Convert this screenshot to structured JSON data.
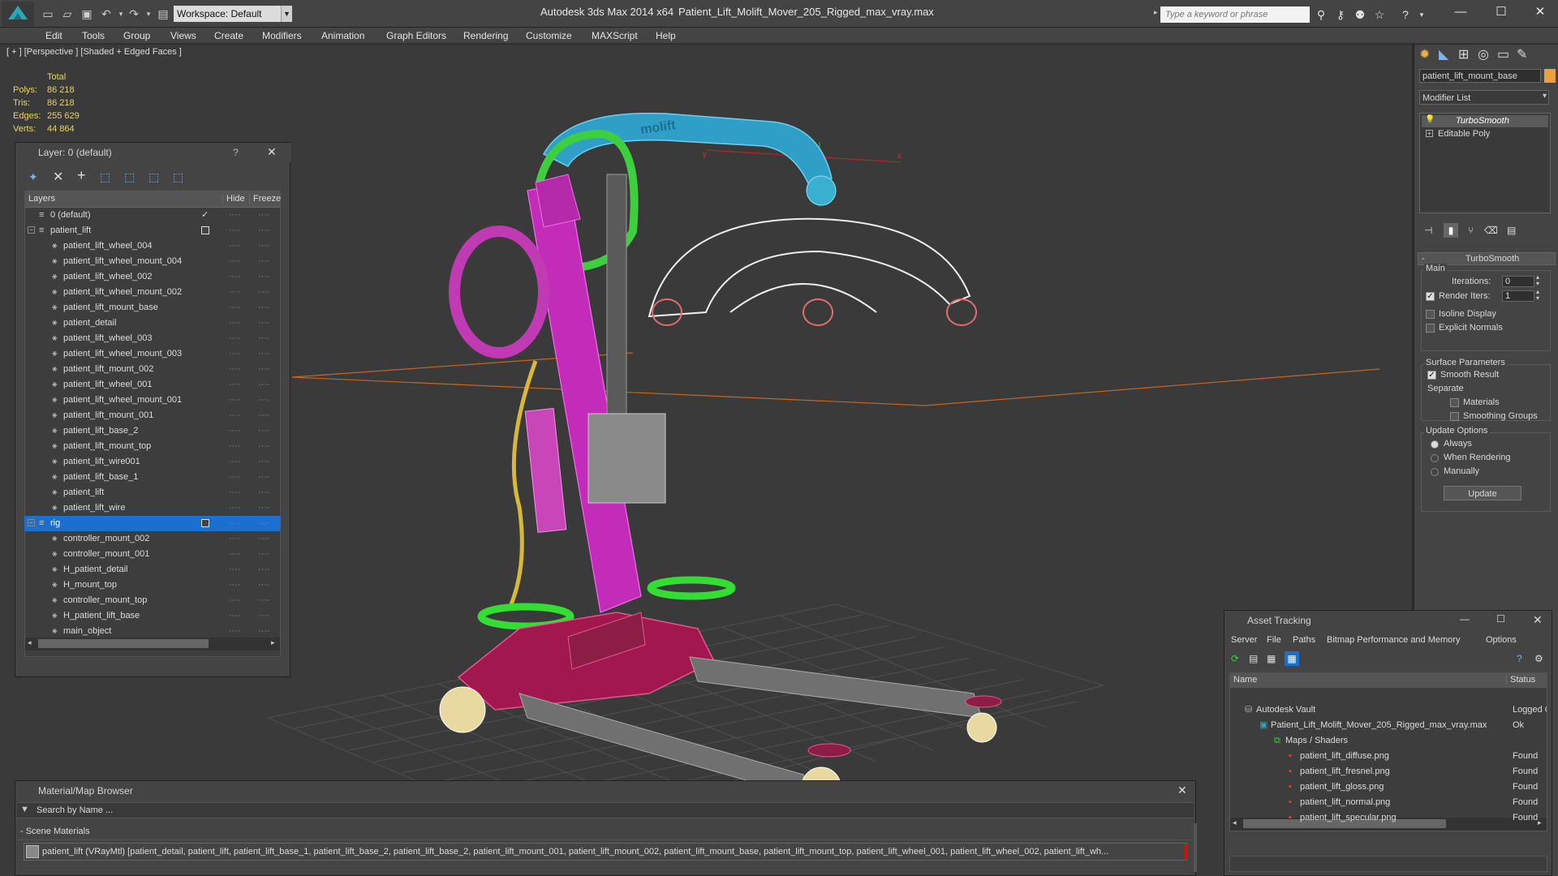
{
  "titlebar": {
    "workspace_label": "Workspace: Default",
    "app_name": "Autodesk 3ds Max  2014 x64",
    "file_name": "Patient_Lift_Molift_Mover_205_Rigged_max_vray.max",
    "search_placeholder": "Type a keyword or phrase"
  },
  "menu": [
    "Edit",
    "Tools",
    "Group",
    "Views",
    "Create",
    "Modifiers",
    "Animation",
    "Graph Editors",
    "Rendering",
    "Customize",
    "MAXScript",
    "Help"
  ],
  "viewport": {
    "label": "[ + ] [Perspective ] [Shaded + Edged Faces ]",
    "stats_header": "Total",
    "stats": [
      {
        "label": "Polys:",
        "value": "86 218"
      },
      {
        "label": "Tris:",
        "value": "86 218"
      },
      {
        "label": "Edges:",
        "value": "255 629"
      },
      {
        "label": "Verts:",
        "value": "44 864"
      }
    ],
    "axis_x": "x",
    "axis_y": "y",
    "logo_text": "molift"
  },
  "layer_panel": {
    "title": "Layer: 0 (default)",
    "help": "?",
    "col_layers": "Layers",
    "col_hide": "Hide",
    "col_freeze": "Freeze",
    "rows": [
      {
        "name": "0 (default)",
        "level": 0,
        "expander": "",
        "check": true
      },
      {
        "name": "patient_lift",
        "level": 0,
        "expander": "−",
        "box": true
      },
      {
        "name": "patient_lift_wheel_004",
        "level": 1
      },
      {
        "name": "patient_lift_wheel_mount_004",
        "level": 1
      },
      {
        "name": "patient_lift_wheel_002",
        "level": 1
      },
      {
        "name": "patient_lift_wheel_mount_002",
        "level": 1
      },
      {
        "name": "patient_lift_mount_base",
        "level": 1
      },
      {
        "name": "patient_detail",
        "level": 1
      },
      {
        "name": "patient_lift_wheel_003",
        "level": 1
      },
      {
        "name": "patient_lift_wheel_mount_003",
        "level": 1
      },
      {
        "name": "patient_lift_mount_002",
        "level": 1
      },
      {
        "name": "patient_lift_wheel_001",
        "level": 1
      },
      {
        "name": "patient_lift_wheel_mount_001",
        "level": 1
      },
      {
        "name": "patient_lift_mount_001",
        "level": 1
      },
      {
        "name": "patient_lift_base_2",
        "level": 1
      },
      {
        "name": "patient_lift_mount_top",
        "level": 1
      },
      {
        "name": "patient_lift_wire001",
        "level": 1
      },
      {
        "name": "patient_lift_base_1",
        "level": 1
      },
      {
        "name": "patient_lift",
        "level": 1
      },
      {
        "name": "patient_lift_wire",
        "level": 1
      },
      {
        "name": "rig",
        "level": 0,
        "expander": "−",
        "box": true,
        "selected": true
      },
      {
        "name": "controller_mount_002",
        "level": 1
      },
      {
        "name": "controller_mount_001",
        "level": 1
      },
      {
        "name": "H_patient_detail",
        "level": 1
      },
      {
        "name": "H_mount_top",
        "level": 1
      },
      {
        "name": "controller_mount_top",
        "level": 1
      },
      {
        "name": "H_patient_lift_base",
        "level": 1
      },
      {
        "name": "main_object",
        "level": 1
      }
    ]
  },
  "command_panel": {
    "object_name": "patient_lift_mount_base",
    "object_color": "#e8a23a",
    "modifier_list": "Modifier List",
    "stack": [
      "TurboSmooth",
      "Editable Poly"
    ],
    "rollout_title": "TurboSmooth",
    "main_label": "Main",
    "iterations_label": "Iterations:",
    "iterations_value": "0",
    "render_iters_label": "Render Iters:",
    "render_iters_value": "1",
    "isoline_label": "Isoline Display",
    "explicit_normals_label": "Explicit Normals",
    "surface_label": "Surface Parameters",
    "smooth_result_label": "Smooth Result",
    "separate_label": "Separate",
    "materials_label": "Materials",
    "smoothing_groups_label": "Smoothing Groups",
    "update_options_label": "Update Options",
    "always_label": "Always",
    "when_rendering_label": "When Rendering",
    "manually_label": "Manually",
    "update_button": "Update"
  },
  "asset_panel": {
    "title": "Asset Tracking",
    "menu": [
      "Server",
      "File",
      "Paths",
      "Bitmap Performance and Memory",
      "Options"
    ],
    "col_name": "Name",
    "col_status": "Status",
    "rows": [
      {
        "name": "Autodesk Vault",
        "status": "Logged O",
        "indent": 1,
        "icon": "vault-icon"
      },
      {
        "name": "Patient_Lift_Molift_Mover_205_Rigged_max_vray.max",
        "status": "Ok",
        "indent": 2,
        "icon": "max-file-icon"
      },
      {
        "name": "Maps / Shaders",
        "status": "",
        "indent": 3,
        "icon": "maps-icon"
      },
      {
        "name": "patient_lift_diffuse.png",
        "status": "Found",
        "indent": 4,
        "icon": "png-icon"
      },
      {
        "name": "patient_lift_fresnel.png",
        "status": "Found",
        "indent": 4,
        "icon": "png-icon"
      },
      {
        "name": "patient_lift_gloss.png",
        "status": "Found",
        "indent": 4,
        "icon": "png-icon"
      },
      {
        "name": "patient_lift_normal.png",
        "status": "Found",
        "indent": 4,
        "icon": "png-icon"
      },
      {
        "name": "patient_lift_specular.png",
        "status": "Found",
        "indent": 4,
        "icon": "png-icon"
      }
    ]
  },
  "material_panel": {
    "title": "Material/Map Browser",
    "search_placeholder": "Search by Name ...",
    "section": "- Scene Materials",
    "material_row": "patient_lift (VRayMtl) [patient_detail, patient_lift, patient_lift_base_1, patient_lift_base_2, patient_lift_base_2, patient_lift_mount_001, patient_lift_mount_002, patient_lift_mount_base, patient_lift_mount_top, patient_lift_wheel_001, patient_lift_wheel_002, patient_lift_wh..."
  }
}
